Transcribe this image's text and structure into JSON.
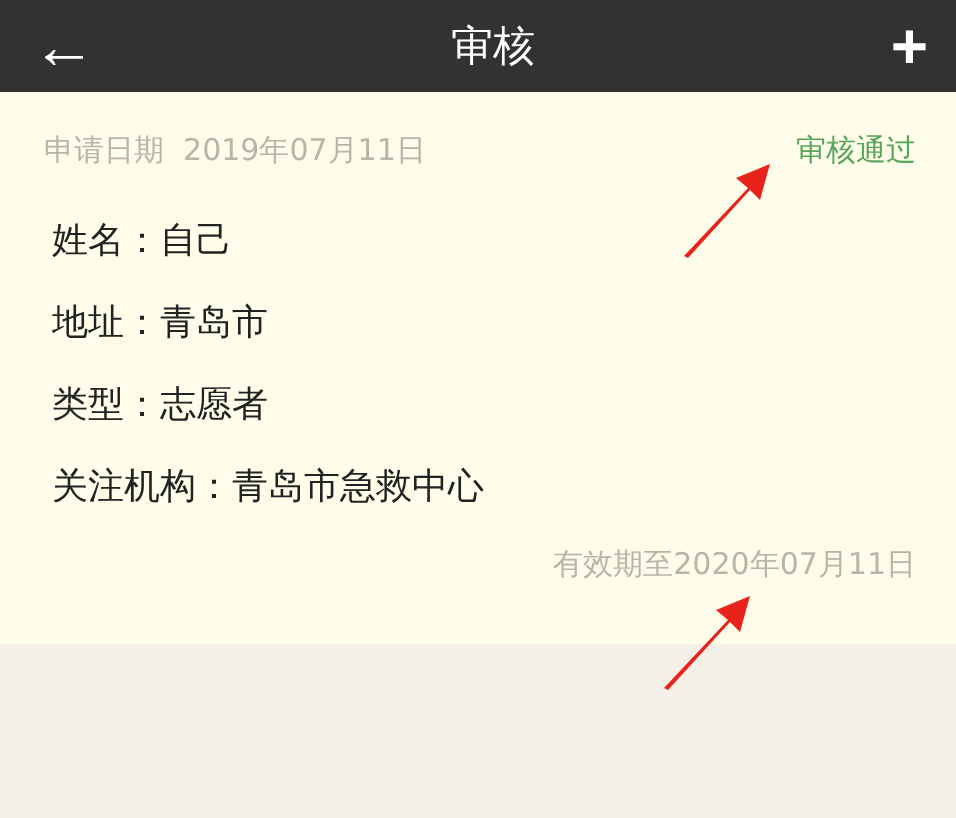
{
  "header": {
    "back": "←",
    "title": "审核",
    "add": "+"
  },
  "application": {
    "date_label": "申请日期",
    "date": "2019年07月11日",
    "status": {
      "label": "审核通过",
      "kind": "approved"
    },
    "fields": [
      {
        "label": "姓名：",
        "value": "自己"
      },
      {
        "label": "地址：",
        "value": "青岛市"
      },
      {
        "label": "类型：",
        "value": "志愿者"
      },
      {
        "label": "关注机构：",
        "value": "青岛市急救中心"
      }
    ],
    "validity": "有效期至2020年07月11日"
  }
}
